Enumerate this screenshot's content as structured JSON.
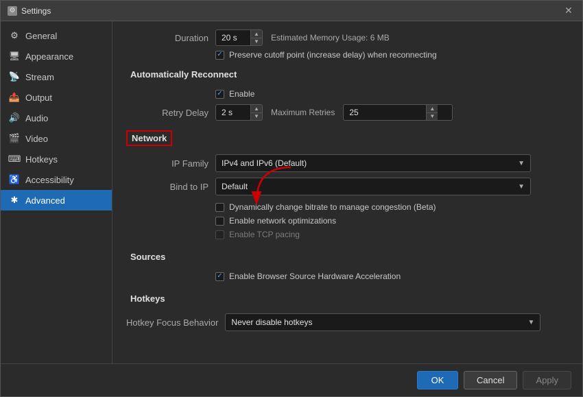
{
  "window": {
    "title": "Settings",
    "close_label": "✕"
  },
  "sidebar": {
    "items": [
      {
        "id": "general",
        "label": "General",
        "icon": "⚙"
      },
      {
        "id": "appearance",
        "label": "Appearance",
        "icon": "🖥"
      },
      {
        "id": "stream",
        "label": "Stream",
        "icon": "📡"
      },
      {
        "id": "output",
        "label": "Output",
        "icon": "📤"
      },
      {
        "id": "audio",
        "label": "Audio",
        "icon": "🔊"
      },
      {
        "id": "video",
        "label": "Video",
        "icon": "🎬"
      },
      {
        "id": "hotkeys",
        "label": "Hotkeys",
        "icon": "⌨"
      },
      {
        "id": "accessibility",
        "label": "Accessibility",
        "icon": "♿"
      },
      {
        "id": "advanced",
        "label": "Advanced",
        "icon": "✱",
        "active": true
      }
    ]
  },
  "main": {
    "duration_label": "Duration",
    "duration_value": "20 s",
    "memory_label": "Estimated Memory Usage: 6 MB",
    "preserve_label": "Preserve cutoff point (increase delay) when reconnecting",
    "auto_reconnect_title": "Automatically Reconnect",
    "enable_label": "Enable",
    "retry_delay_label": "Retry Delay",
    "retry_delay_value": "2 s",
    "max_retries_label": "Maximum Retries",
    "max_retries_value": "25",
    "network_title": "Network",
    "ip_family_label": "IP Family",
    "ip_family_value": "IPv4 and IPv6 (Default)",
    "bind_to_ip_label": "Bind to IP",
    "bind_to_ip_value": "Default",
    "dynamic_bitrate_label": "Dynamically change bitrate to manage congestion (Beta)",
    "network_opt_label": "Enable network optimizations",
    "tcp_pacing_label": "Enable TCP pacing",
    "sources_title": "Sources",
    "browser_accel_label": "Enable Browser Source Hardware Acceleration",
    "hotkeys_title": "Hotkeys",
    "hotkey_focus_label": "Hotkey Focus Behavior",
    "hotkey_focus_value": "Never disable hotkeys",
    "btn_ok": "OK",
    "btn_cancel": "Cancel",
    "btn_apply": "Apply"
  }
}
